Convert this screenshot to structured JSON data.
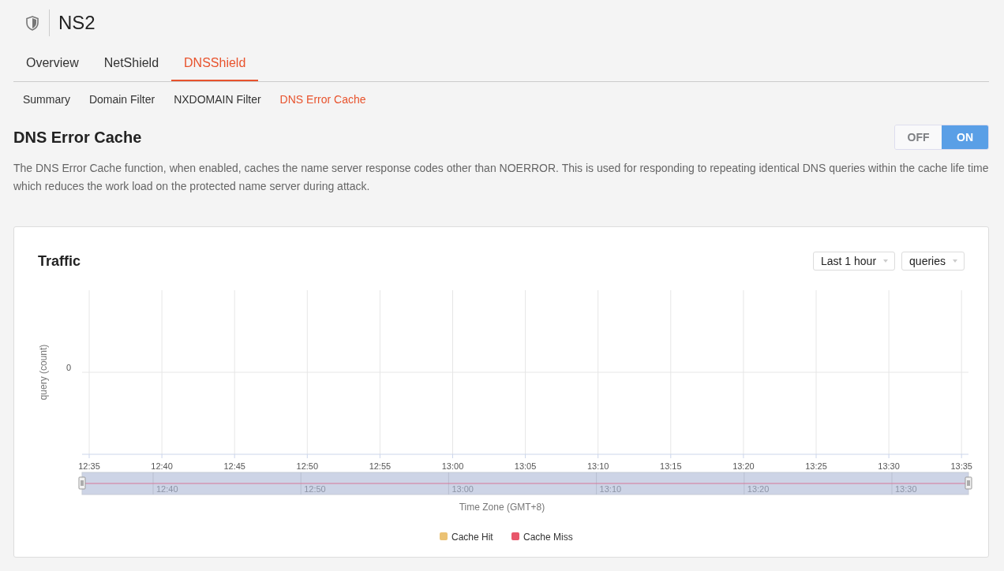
{
  "header": {
    "title": "NS2"
  },
  "tabs": [
    {
      "label": "Overview",
      "selected": false
    },
    {
      "label": "NetShield",
      "selected": false
    },
    {
      "label": "DNSShield",
      "selected": true
    }
  ],
  "subtabs": [
    {
      "label": "Summary",
      "selected": false
    },
    {
      "label": "Domain Filter",
      "selected": false
    },
    {
      "label": "NXDOMAIN Filter",
      "selected": false
    },
    {
      "label": "DNS Error Cache",
      "selected": true
    }
  ],
  "section": {
    "title": "DNS Error Cache",
    "toggle": [
      {
        "label": "OFF",
        "selected": false
      },
      {
        "label": "ON",
        "selected": true
      }
    ],
    "description": "The DNS Error Cache function, when enabled, caches the name server response codes other than NOERROR. This is used for responding to repeating identical DNS queries within the cache life time which reduces the work load on the protected name server during attack."
  },
  "traffic": {
    "title": "Traffic",
    "range_select": "Last 1 hour",
    "metric_select": "queries",
    "chart": {
      "x_axis_label": "Time Zone (GMT+8)",
      "y_axis_label": "query (count)",
      "x_ticks": [
        "12:35",
        "12:40",
        "12:45",
        "12:50",
        "12:55",
        "13:00",
        "13:05",
        "13:10",
        "13:15",
        "13:20",
        "13:25",
        "13:30",
        "13:35"
      ],
      "y_ticks": [
        "0"
      ],
      "legend": [
        {
          "label": "Cache Hit",
          "color": "#ebc274"
        },
        {
          "label": "Cache Miss",
          "color": "#e8566a"
        }
      ]
    },
    "navigator": {
      "labels": [
        "12:40",
        "12:50",
        "13:00",
        "13:10",
        "13:20",
        "13:30"
      ]
    }
  }
}
